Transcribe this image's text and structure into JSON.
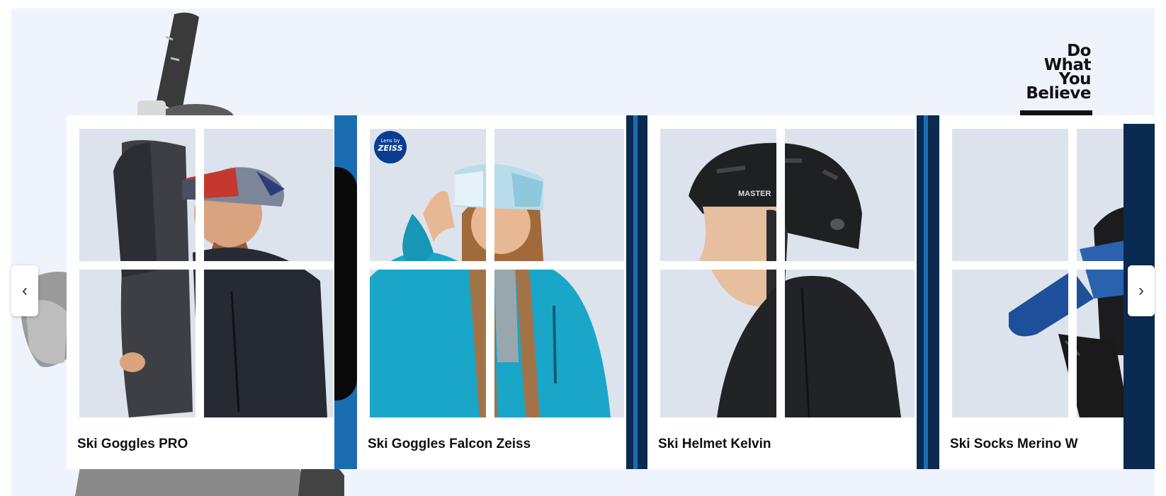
{
  "brand": {
    "lines": [
      "Do",
      "What",
      "You",
      "Believe"
    ]
  },
  "carousel": {
    "prev_icon": "chevron-left-icon",
    "next_icon": "chevron-right-icon",
    "prev_glyph": "‹",
    "next_glyph": "›",
    "cards": [
      {
        "label": "Ski Goggles PRO"
      },
      {
        "label": "Ski Goggles Falcon Zeiss",
        "badge": {
          "line1": "Lens by",
          "line2": "ZEISS"
        }
      },
      {
        "label": "Ski Helmet Kelvin",
        "helmet_text": "MASTER"
      },
      {
        "label": "Ski Socks Merino W"
      }
    ]
  },
  "colors": {
    "hero_bg": "#eff4fc",
    "tile_bg": "#dde3ec",
    "navy": "#0b2a4f",
    "blue_stripe": "#1b6db2",
    "zeiss_blue": "#0a3d91",
    "jacket_teal": "#1aa6c8"
  }
}
